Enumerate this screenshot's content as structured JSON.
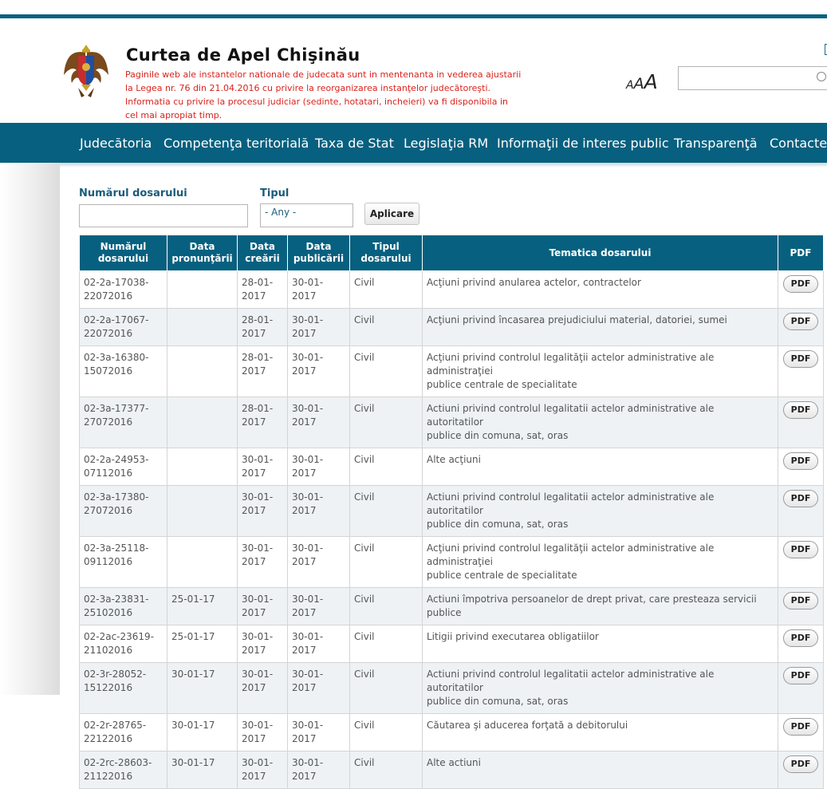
{
  "header": {
    "site_title": "Curtea de Apel Chişinău",
    "notice_lines": [
      "Paginile web ale instantelor nationale de judecata sunt in mentenanta in vederea ajustarii",
      "la Legea nr. 76 din 21.04.2016 cu privire la reorganizarea instanţelor judecătoreşti.",
      "Informatia cu privire la procesul judiciar (sedinte, hotatari, incheieri) va fi disponibila in",
      "cel mai apropiat timp."
    ],
    "font_size_small": "A",
    "font_size_medium": "A",
    "font_size_large": "A",
    "search_value": ""
  },
  "nav": {
    "items": [
      "Judecătoria",
      "Competenţa teritorială",
      "Taxa de Stat",
      "Legislaţia RM",
      "Informaţii de interes public",
      "Transparenţă",
      "Contacte"
    ]
  },
  "filters": {
    "case_number_label": "Numărul dosarului",
    "case_number_value": "",
    "type_label": "Tipul",
    "type_selected": "- Any -",
    "apply_label": "Aplicare"
  },
  "table": {
    "headers": [
      [
        "Numărul",
        "dosarului"
      ],
      [
        "Data",
        "pronunţării"
      ],
      [
        "Data",
        "creării"
      ],
      [
        "Data",
        "publicării"
      ],
      [
        "Tipul",
        "dosarului"
      ],
      [
        "Tematica dosarului"
      ],
      [
        "PDF"
      ]
    ],
    "pdf_label": "PDF",
    "rows": [
      {
        "num": [
          "02-2a-17038-",
          "22072016"
        ],
        "pron": "",
        "creat": [
          "28-01-",
          "2017"
        ],
        "publ": "30-01-2017",
        "tip": "Civil",
        "tema": [
          "Acţiuni privind anularea actelor, contractelor"
        ]
      },
      {
        "num": [
          "02-2a-17067-",
          "22072016"
        ],
        "pron": "",
        "creat": [
          "28-01-",
          "2017"
        ],
        "publ": "30-01-2017",
        "tip": "Civil",
        "tema": [
          "Acţiuni privind încasarea prejudiciului material, datoriei, sumei"
        ]
      },
      {
        "num": [
          "02-3a-16380-",
          "15072016"
        ],
        "pron": "",
        "creat": [
          "28-01-",
          "2017"
        ],
        "publ": "30-01-2017",
        "tip": "Civil",
        "tema": [
          "Acţiuni privind controlul legalităţii actelor administrative ale administraţiei",
          "publice centrale de specialitate"
        ]
      },
      {
        "num": [
          "02-3a-17377-",
          "27072016"
        ],
        "pron": "",
        "creat": [
          "28-01-",
          "2017"
        ],
        "publ": "30-01-2017",
        "tip": "Civil",
        "tema": [
          "Actiuni privind controlul legalitatii actelor administrative ale autoritatilor",
          "publice din comuna, sat, oras"
        ]
      },
      {
        "num": [
          "02-2a-24953-",
          "07112016"
        ],
        "pron": "",
        "creat": [
          "30-01-",
          "2017"
        ],
        "publ": "30-01-2017",
        "tip": "Civil",
        "tema": [
          "Alte acţiuni"
        ]
      },
      {
        "num": [
          "02-3a-17380-",
          "27072016"
        ],
        "pron": "",
        "creat": [
          "30-01-",
          "2017"
        ],
        "publ": "30-01-2017",
        "tip": "Civil",
        "tema": [
          "Actiuni privind controlul legalitatii actelor administrative ale autoritatilor",
          "publice din comuna, sat, oras"
        ]
      },
      {
        "num": [
          "02-3a-25118-",
          "09112016"
        ],
        "pron": "",
        "creat": [
          "30-01-",
          "2017"
        ],
        "publ": "30-01-2017",
        "tip": "Civil",
        "tema": [
          "Acţiuni privind controlul legalităţii actelor administrative ale administraţiei",
          "publice centrale de specialitate"
        ]
      },
      {
        "num": [
          "02-3a-23831-",
          "25102016"
        ],
        "pron": "25-01-17",
        "creat": [
          "30-01-",
          "2017"
        ],
        "publ": "30-01-2017",
        "tip": "Civil",
        "tema": [
          "Actiuni împotriva persoanelor de drept privat, care presteaza servicii publice"
        ]
      },
      {
        "num": [
          "02-2ac-23619-",
          "21102016"
        ],
        "pron": "25-01-17",
        "creat": [
          "30-01-",
          "2017"
        ],
        "publ": "30-01-2017",
        "tip": "Civil",
        "tema": [
          "Litigii privind executarea obligatiilor"
        ]
      },
      {
        "num": [
          "02-3r-28052-",
          "15122016"
        ],
        "pron": "30-01-17",
        "creat": [
          "30-01-",
          "2017"
        ],
        "publ": "30-01-2017",
        "tip": "Civil",
        "tema": [
          "Actiuni privind controlul legalitatii actelor administrative ale autoritatilor",
          "publice din comuna, sat, oras"
        ]
      },
      {
        "num": [
          "02-2r-28765-",
          "22122016"
        ],
        "pron": "30-01-17",
        "creat": [
          "30-01-",
          "2017"
        ],
        "publ": "30-01-2017",
        "tip": "Civil",
        "tema": [
          "Căutarea şi aducerea forţată a debitorului"
        ]
      },
      {
        "num": [
          "02-2rc-28603-",
          "21122016"
        ],
        "pron": "30-01-17",
        "creat": [
          "30-01-",
          "2017"
        ],
        "publ": "30-01-2017",
        "tip": "Civil",
        "tema": [
          "Alte actiuni"
        ]
      }
    ]
  }
}
